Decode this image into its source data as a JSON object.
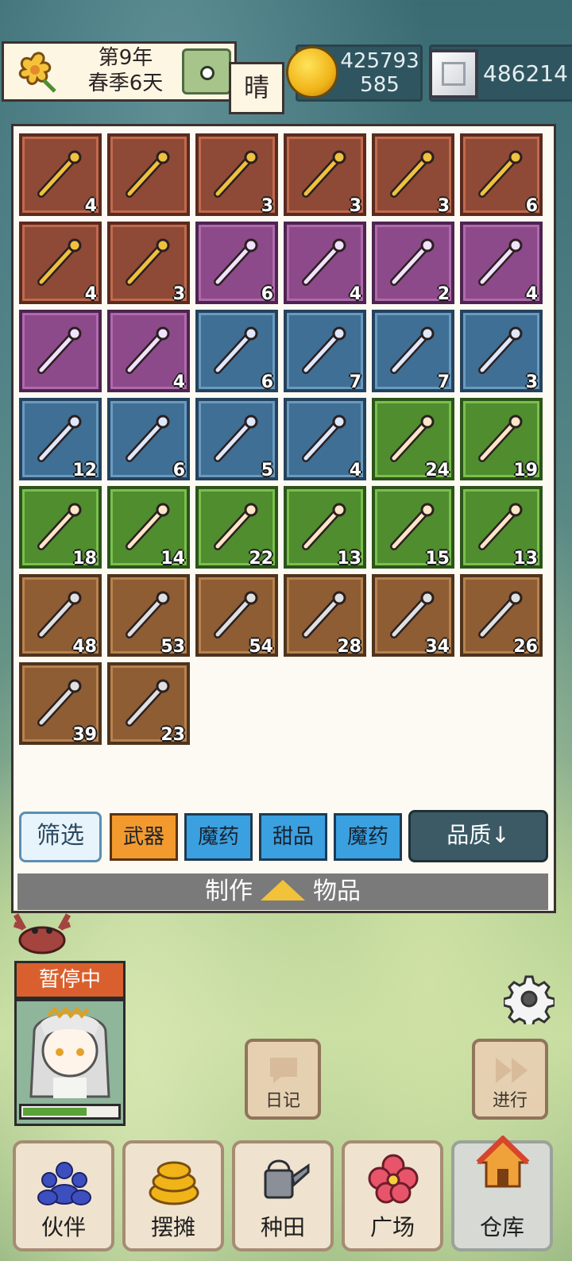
{
  "header": {
    "date_line1": "第9年",
    "date_line2": "春季6天",
    "weather": "晴",
    "gold_line1": "425793",
    "gold_line2": "585",
    "gems": "486214"
  },
  "inventory": [
    {
      "q": "red",
      "icon": "trident-icon",
      "count": "4"
    },
    {
      "q": "red",
      "icon": "golden-whip-icon",
      "count": ""
    },
    {
      "q": "red",
      "icon": "rainbow-wand-icon",
      "count": "3"
    },
    {
      "q": "red",
      "icon": "demon-crest-icon",
      "count": "3"
    },
    {
      "q": "red",
      "icon": "rainbow-shield-icon",
      "count": "3"
    },
    {
      "q": "red",
      "icon": "golden-horn-icon",
      "count": "6"
    },
    {
      "q": "red",
      "icon": "crystal-staff-icon",
      "count": "4"
    },
    {
      "q": "red",
      "icon": "flame-sword-icon",
      "count": "3"
    },
    {
      "q": "purple",
      "icon": "wooden-club-icon",
      "count": "6"
    },
    {
      "q": "purple",
      "icon": "twin-daggers-icon",
      "count": "4"
    },
    {
      "q": "purple",
      "icon": "ice-sword-icon",
      "count": "2"
    },
    {
      "q": "purple",
      "icon": "fire-orb-icon",
      "count": "4"
    },
    {
      "q": "purple",
      "icon": "orange-axe-icon",
      "count": ""
    },
    {
      "q": "purple",
      "icon": "ice-blade-icon",
      "count": "4"
    },
    {
      "q": "blue",
      "icon": "dark-spear-icon",
      "count": "6"
    },
    {
      "q": "blue",
      "icon": "cleaver-icon",
      "count": "7"
    },
    {
      "q": "blue",
      "icon": "fire-staff-icon",
      "count": "7"
    },
    {
      "q": "blue",
      "icon": "crossed-swords-icon",
      "count": "3"
    },
    {
      "q": "blue",
      "icon": "blue-orb-icon",
      "count": "12"
    },
    {
      "q": "blue",
      "icon": "scythe-icon",
      "count": "6"
    },
    {
      "q": "blue",
      "icon": "golden-spear-icon",
      "count": "5"
    },
    {
      "q": "blue",
      "icon": "frost-axe-icon",
      "count": "4"
    },
    {
      "q": "green",
      "icon": "torch-spear-icon",
      "count": "24"
    },
    {
      "q": "green",
      "icon": "moon-axe-icon",
      "count": "19"
    },
    {
      "q": "green",
      "icon": "cyan-sword-icon",
      "count": "18"
    },
    {
      "q": "green",
      "icon": "web-shield-icon",
      "count": "14"
    },
    {
      "q": "green",
      "icon": "green-orb-icon",
      "count": "22"
    },
    {
      "q": "green",
      "icon": "thorn-branch-icon",
      "count": "13"
    },
    {
      "q": "green",
      "icon": "red-staff-icon",
      "count": "15"
    },
    {
      "q": "green",
      "icon": "blue-dagger-icon",
      "count": "13"
    },
    {
      "q": "brown",
      "icon": "wood-club-icon",
      "count": "48"
    },
    {
      "q": "brown",
      "icon": "machete-icon",
      "count": "53"
    },
    {
      "q": "brown",
      "icon": "rapier-icon",
      "count": "54"
    },
    {
      "q": "brown",
      "icon": "crystal-gem-icon",
      "count": "28"
    },
    {
      "q": "brown",
      "icon": "wooden-shield-icon",
      "count": "34"
    },
    {
      "q": "brown",
      "icon": "pickaxe-icon",
      "count": "26"
    },
    {
      "q": "brown",
      "icon": "fish-sword-icon",
      "count": "39"
    },
    {
      "q": "brown",
      "icon": "crossbow-icon",
      "count": "23"
    }
  ],
  "filters": {
    "filter_label": "筛选",
    "tabs": [
      "武器",
      "魔药",
      "甜品",
      "魔药"
    ],
    "quality_label": "品质↓"
  },
  "craft_bar": {
    "left": "制作",
    "right": "物品"
  },
  "character": {
    "status": "暂停中",
    "hp_fraction": 0.68
  },
  "side_buttons": {
    "diary": "日记",
    "proceed": "进行"
  },
  "nav": [
    "伙伴",
    "摆摊",
    "种田",
    "广场",
    "仓库"
  ],
  "colors": {
    "red": "#8e4a36",
    "purple": "#8d4a8a",
    "blue": "#3f6f95",
    "green": "#4f8d2f",
    "brown": "#8e5d34",
    "accent_orange": "#f29a2e",
    "accent_blue": "#3aa0df"
  }
}
